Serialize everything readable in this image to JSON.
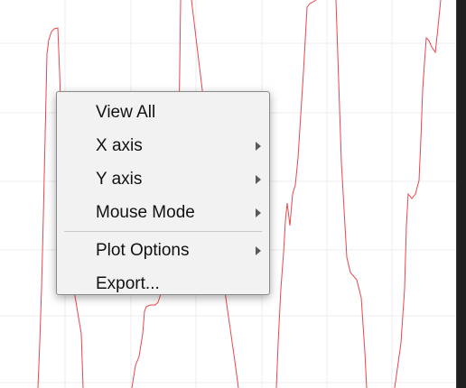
{
  "plot": {
    "trace_color": "#e8484c",
    "grid_color": "#ececec",
    "background": "#ffffff"
  },
  "context_menu": {
    "items": [
      {
        "label": "View All",
        "submenu": false
      },
      {
        "label": "X axis",
        "submenu": true,
        "icon": "chevron-right-icon"
      },
      {
        "label": "Y axis",
        "submenu": true,
        "icon": "chevron-right-icon"
      },
      {
        "label": "Mouse Mode",
        "submenu": true,
        "icon": "chevron-right-icon"
      },
      {
        "label": "Plot Options",
        "submenu": true,
        "icon": "chevron-right-icon"
      },
      {
        "label": "Export...",
        "submenu": false
      }
    ]
  }
}
